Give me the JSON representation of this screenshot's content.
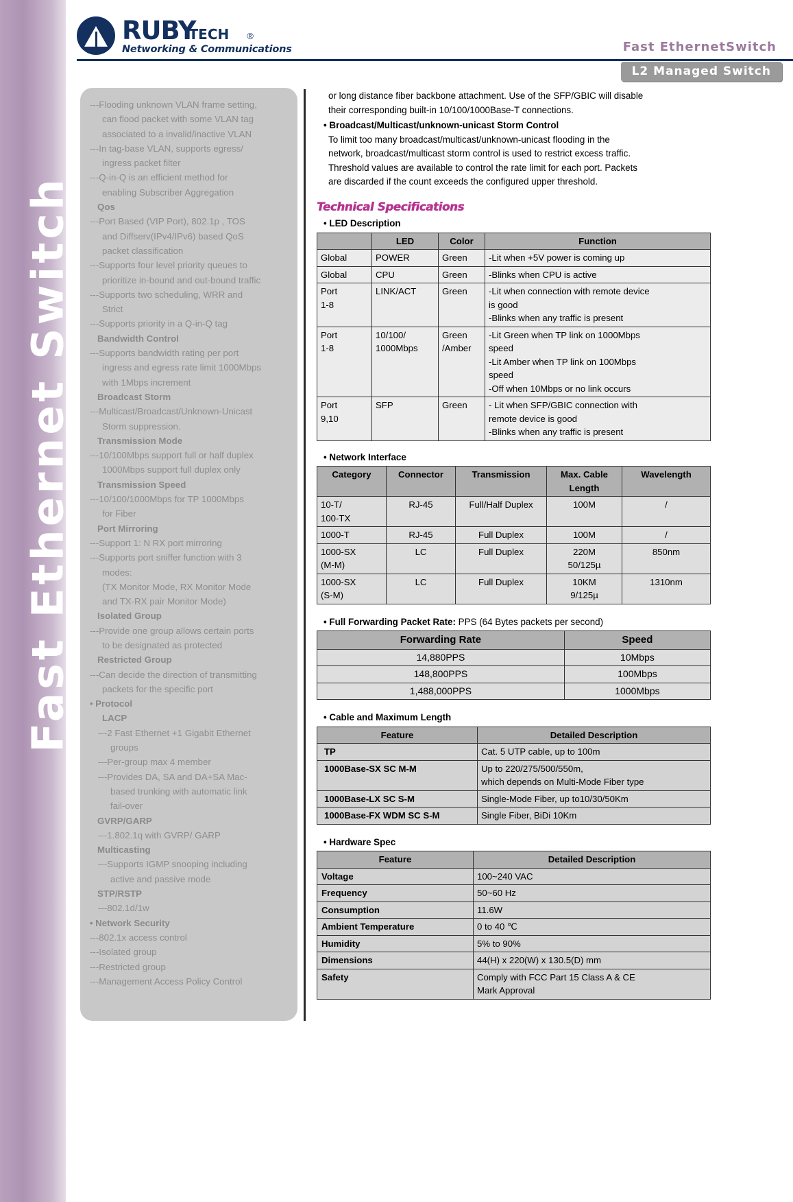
{
  "header": {
    "logo_brand": "RUBY",
    "logo_sub_brand": "TECH",
    "logo_registered": "®",
    "logo_tagline": "Networking & Communications",
    "title": "Fast EthernetSwitch",
    "badge": "L2 Managed Switch"
  },
  "spine": {
    "title": "Fast Ethernet Switch"
  },
  "left_column": [
    {
      "style": "item",
      "text": "---Flooding unknown VLAN frame setting,"
    },
    {
      "style": "sub",
      "text": "can flood packet with some VLAN tag"
    },
    {
      "style": "sub",
      "text": "associated to a invalid/inactive VLAN"
    },
    {
      "style": "item",
      "text": "---In tag-base VLAN, supports egress/"
    },
    {
      "style": "sub",
      "text": "ingress packet filter"
    },
    {
      "style": "item",
      "text": "---Q-in-Q is an efficient method for"
    },
    {
      "style": "sub",
      "text": "enabling Subscriber Aggregation"
    },
    {
      "style": "head",
      "text": "Qos"
    },
    {
      "style": "item",
      "text": "---Port Based (VIP Port), 802.1p , TOS"
    },
    {
      "style": "sub",
      "text": "and Diffserv(IPv4/IPv6) based QoS"
    },
    {
      "style": "sub",
      "text": "packet classification"
    },
    {
      "style": "item",
      "text": "---Supports four level priority queues to"
    },
    {
      "style": "sub",
      "text": "prioritize in-bound and out-bound traffic"
    },
    {
      "style": "item",
      "text": "---Supports two scheduling, WRR and"
    },
    {
      "style": "sub",
      "text": "Strict"
    },
    {
      "style": "item",
      "text": " ---Supports priority in a Q-in-Q tag"
    },
    {
      "style": "head",
      "text": "Bandwidth Control"
    },
    {
      "style": "item",
      "text": "---Supports bandwidth rating per port"
    },
    {
      "style": "sub",
      "text": "ingress and egress rate limit 1000Mbps"
    },
    {
      "style": "sub",
      "text": "with 1Mbps increment"
    },
    {
      "style": "head",
      "text": "Broadcast Storm"
    },
    {
      "style": "item",
      "text": "---Multicast/Broadcast/Unknown-Unicast"
    },
    {
      "style": "sub",
      "text": "Storm suppression."
    },
    {
      "style": "head",
      "text": "Transmission Mode"
    },
    {
      "style": "item",
      "text": "---10/100Mbps support full or half duplex"
    },
    {
      "style": "sub",
      "text": "1000Mbps support full duplex only"
    },
    {
      "style": "head",
      "text": "Transmission Speed"
    },
    {
      "style": "item",
      "text": "---10/100/1000Mbps for TP 1000Mbps"
    },
    {
      "style": "sub",
      "text": "for Fiber"
    },
    {
      "style": "head",
      "text": "Port Mirroring"
    },
    {
      "style": "item",
      "text": "---Support 1: N RX port mirroring"
    },
    {
      "style": "item",
      "text": "---Supports port sniffer function with 3"
    },
    {
      "style": "sub",
      "text": "modes:"
    },
    {
      "style": "sub",
      "text": "(TX Monitor Mode, RX Monitor Mode"
    },
    {
      "style": "sub",
      "text": "and TX-RX pair Monitor Mode)"
    },
    {
      "style": "head",
      "text": "Isolated Group"
    },
    {
      "style": "item",
      "text": "---Provide one group allows certain ports"
    },
    {
      "style": "sub",
      "text": "to be designated as protected"
    },
    {
      "style": "head",
      "text": "Restricted Group"
    },
    {
      "style": "item",
      "text": "---Can decide the direction of transmitting"
    },
    {
      "style": "sub",
      "text": "packets for the specific port"
    },
    {
      "style": "bullet",
      "text": "Protocol"
    },
    {
      "style": "head-indent",
      "text": "LACP"
    },
    {
      "style": "item-indent",
      "text": "---2 Fast Ethernet +1 Gigabit Ethernet"
    },
    {
      "style": "sub-indent",
      "text": "groups"
    },
    {
      "style": "item-indent",
      "text": "---Per-group max 4 member"
    },
    {
      "style": "item-indent",
      "text": "---Provides DA, SA and DA+SA Mac-"
    },
    {
      "style": "sub-indent",
      "text": "based trunking with automatic link"
    },
    {
      "style": "sub-indent",
      "text": "fail-over"
    },
    {
      "style": "head",
      "text": "GVRP/GARP"
    },
    {
      "style": "item-indent",
      "text": "---1.802.1q with GVRP/ GARP"
    },
    {
      "style": "head",
      "text": "Multicasting"
    },
    {
      "style": "item-indent",
      "text": "---Supports IGMP snooping including"
    },
    {
      "style": "sub-indent",
      "text": "active and passive mode"
    },
    {
      "style": "head",
      "text": "STP/RSTP"
    },
    {
      "style": "item-indent",
      "text": "---802.1d/1w"
    },
    {
      "style": "bullet",
      "text": "Network Security"
    },
    {
      "style": "item",
      "text": "---802.1x access control"
    },
    {
      "style": "item",
      "text": "---Isolated group"
    },
    {
      "style": "item",
      "text": "---Restricted group"
    },
    {
      "style": "item",
      "text": "---Management Access Policy Control"
    }
  ],
  "right_column": {
    "intro_lines": [
      "or long distance fiber backbone attachment. Use of the SFP/GBIC will disable",
      "their corresponding built-in 10/100/1000Base-T connections."
    ],
    "storm_bullet": "Broadcast/Multicast/unknown-unicast Storm Control",
    "storm_body": [
      "To limit too many broadcast/multicast/unknown-unicast flooding in the",
      "network, broadcast/multicast storm control is used to restrict excess traffic.",
      "Threshold values are available to control the rate limit for each port. Packets",
      "are discarded if the count exceeds the configured upper threshold."
    ],
    "tech_spec_title": "Technical Specifications",
    "led": {
      "section_title": "LED Description",
      "headers": [
        "",
        "LED",
        "Color",
        "Function"
      ],
      "rows": [
        {
          "scope": "Global",
          "led": "POWER",
          "color": "Green",
          "function": [
            "-Lit when +5V power is coming up"
          ]
        },
        {
          "scope": "Global",
          "led": "CPU",
          "color": "Green",
          "function": [
            "-Blinks when CPU is active"
          ]
        },
        {
          "scope": "Port\n1-8",
          "led": "LINK/ACT",
          "color": "Green",
          "function": [
            " -Lit when connection with remote device",
            "   is good",
            "-Blinks when any traffic is present"
          ]
        },
        {
          "scope": "Port\n1-8",
          "led": "10/100/\n1000Mbps",
          "color": "Green\n/Amber",
          "function": [
            " -Lit  Green when TP link on 1000Mbps",
            "  speed",
            " -Lit Amber when TP link on 100Mbps",
            "  speed",
            "-Off when 10Mbps or no link occurs"
          ]
        },
        {
          "scope": "Port\n9,10",
          "led": "SFP",
          "color": "Green",
          "function": [
            " - Lit when SFP/GBIC connection with",
            "   remote device is good",
            "-Blinks when any traffic is present"
          ]
        }
      ]
    },
    "network": {
      "section_title": "Network Interface",
      "headers": [
        "Category",
        "Connector",
        "Transmission",
        "Max. Cable Length",
        "Wavelength"
      ],
      "rows": [
        {
          "category": "10-T/\n100-TX",
          "connector": "RJ-45",
          "transmission": "Full/Half Duplex",
          "length": "100M",
          "wavelength": "/"
        },
        {
          "category": "1000-T",
          "connector": "RJ-45",
          "transmission": "Full Duplex",
          "length": "100M",
          "wavelength": "/"
        },
        {
          "category": "1000-SX\n(M-M)",
          "connector": "LC",
          "transmission": "Full Duplex",
          "length": "220M\n50/125µ",
          "wavelength": "850nm"
        },
        {
          "category": "1000-SX\n(S-M)",
          "connector": "LC",
          "transmission": "Full Duplex",
          "length": "10KM\n9/125µ",
          "wavelength": "1310nm"
        }
      ]
    },
    "forwarding": {
      "section_title_bold": "Full Forwarding Packet Rate:",
      "section_title_normal": " PPS (64 Bytes packets per second)",
      "headers": [
        "Forwarding Rate",
        "Speed"
      ],
      "rows": [
        {
          "rate": "14,880PPS",
          "speed": "10Mbps"
        },
        {
          "rate": "148,800PPS",
          "speed": "100Mbps"
        },
        {
          "rate": "1,488,000PPS",
          "speed": "1000Mbps"
        }
      ]
    },
    "cable": {
      "section_title": "Cable and Maximum Length",
      "headers": [
        "Feature",
        "Detailed Description"
      ],
      "rows": [
        {
          "feature": "TP",
          "description": "Cat. 5 UTP cable, up to 100m"
        },
        {
          "feature": "1000Base-SX SC M-M",
          "description": "Up to 220/275/500/550m,\nwhich depends on Multi-Mode Fiber type"
        },
        {
          "feature": "1000Base-LX SC S-M",
          "description": "Single-Mode Fiber, up to10/30/50Km"
        },
        {
          "feature": "1000Base-FX WDM SC S-M",
          "description": "Single Fiber, BiDi 10Km"
        }
      ]
    },
    "hardware": {
      "section_title": "Hardware Spec",
      "headers": [
        "Feature",
        "Detailed Description"
      ],
      "rows": [
        {
          "feature": "Voltage",
          "description": "100~240 VAC"
        },
        {
          "feature": "Frequency",
          "description": "50~60 Hz"
        },
        {
          "feature": "Consumption",
          "description": "11.6W"
        },
        {
          "feature": "Ambient Temperature",
          "description": "0 to 40 ℃"
        },
        {
          "feature": "Humidity",
          "description": "5% to 90%"
        },
        {
          "feature": "Dimensions",
          "description": " 44(H) x 220(W) x 130.5(D) mm"
        },
        {
          "feature": "Safety",
          "description": "Comply with FCC Part 15 Class A & CE\nMark Approval"
        }
      ]
    }
  }
}
